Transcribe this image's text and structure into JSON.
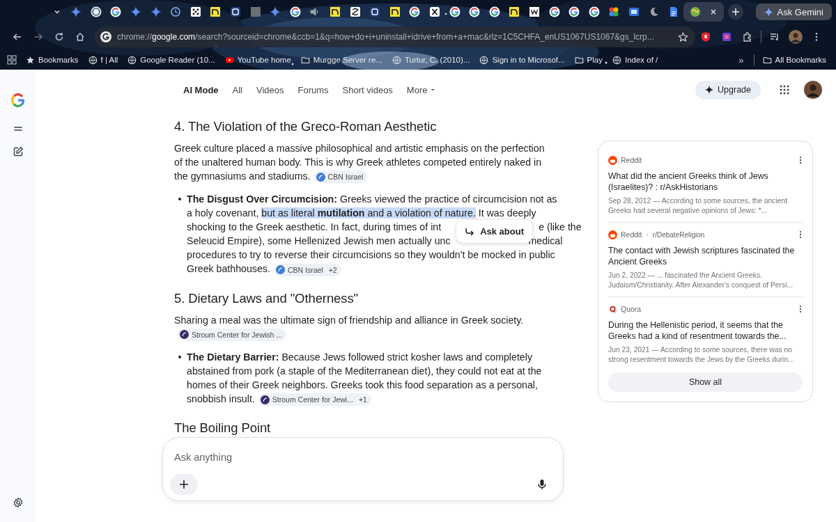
{
  "browser": {
    "tabs": [
      {
        "kind": "gemini",
        "selected": false
      },
      {
        "kind": "wordpress",
        "selected": false
      },
      {
        "kind": "google",
        "selected": false
      },
      {
        "kind": "gemini",
        "selected": false
      },
      {
        "kind": "gemini",
        "selected": false
      },
      {
        "kind": "clock",
        "selected": false
      },
      {
        "kind": "dice",
        "selected": false
      },
      {
        "kind": "yellow",
        "selected": false
      },
      {
        "kind": "site",
        "selected": false
      },
      {
        "kind": "grey",
        "selected": false
      },
      {
        "kind": "gemini",
        "selected": false
      },
      {
        "kind": "google",
        "selected": false
      },
      {
        "kind": "speaker",
        "selected": false
      },
      {
        "kind": "yellow",
        "selected": false
      },
      {
        "kind": "swirl",
        "selected": false
      },
      {
        "kind": "site",
        "selected": false
      },
      {
        "kind": "yellow",
        "selected": false
      },
      {
        "kind": "google",
        "selected": false
      },
      {
        "kind": "x",
        "selected": false
      },
      {
        "kind": "google",
        "selected": false
      },
      {
        "kind": "google",
        "selected": false
      },
      {
        "kind": "google",
        "selected": false
      },
      {
        "kind": "yellow",
        "selected": false
      },
      {
        "kind": "wiki",
        "selected": false
      },
      {
        "kind": "google",
        "selected": false
      },
      {
        "kind": "google",
        "selected": false
      },
      {
        "kind": "google",
        "selected": false
      },
      {
        "kind": "photos",
        "selected": false
      },
      {
        "kind": "screen",
        "selected": false
      },
      {
        "kind": "moon",
        "selected": false
      },
      {
        "kind": "doc",
        "selected": false
      },
      {
        "kind": "globe",
        "selected": true
      }
    ],
    "ask_gemini": "Ask Gemini",
    "address": {
      "scheme": "chrome://",
      "host": "google.com",
      "path": "/search?sourceid=chrome&ccb=1&q=how+do+i+uninstall+idrive+from+a+mac&rlz=1C5CHFA_enUS1067US1067&gs_lcrp..."
    },
    "bookmarks": [
      {
        "kind": "star",
        "label": "Bookmarks"
      },
      {
        "kind": "globe",
        "label": "f | All"
      },
      {
        "kind": "globe",
        "label": "Google Reader (10..."
      },
      {
        "kind": "youtube",
        "label": "YouTube home"
      },
      {
        "kind": "folder",
        "label": "Murgge Server re..."
      },
      {
        "kind": "globe",
        "label": "Turtur, C. (2010)..."
      },
      {
        "kind": "globe",
        "label": "Sign in to Microsof..."
      },
      {
        "kind": "folder",
        "label": "Play"
      },
      {
        "kind": "globe",
        "label": "Index of /"
      }
    ],
    "overflow": "»",
    "all_bookmarks": "All Bookmarks"
  },
  "search_tabs": [
    {
      "label": "AI Mode",
      "selected": true
    },
    {
      "label": "All",
      "selected": false
    },
    {
      "label": "Videos",
      "selected": false
    },
    {
      "label": "Forums",
      "selected": false
    },
    {
      "label": "Short videos",
      "selected": false
    },
    {
      "label": "More",
      "selected": false
    }
  ],
  "upgrade": "Upgrade",
  "content": [
    {
      "kind": "heading",
      "text": "4. The Violation of the Greco-Roman Aesthetic"
    },
    {
      "kind": "paragraph",
      "text": "Greek culture placed a massive philosophical and artistic emphasis on the perfection of the unaltered human body. This is why Greek athletes competed entirely naked in the gymnasiums and stadiums.",
      "chip": {
        "kind": "cbn",
        "label": "CBN Israel"
      }
    },
    {
      "kind": "bullet",
      "lines": [
        {
          "text": "**The Disgust Over Circumcision:** Greeks viewed the practice of circumcision not as"
        },
        {
          "before": "a holy covenant, ",
          "selection": "but as literal **mutilation** and a violation of nature.",
          "after": " It was deeply"
        },
        {
          "left": "shocking to the Greek aesthetic. In fact, during times of int",
          "right": "e (like the"
        },
        {
          "left": "Seleucid Empire), some Hellenized Jewish men actually unc",
          "right": "medical"
        },
        {
          "text": "procedures to try to reverse their circumcisions so they wouldn't be mocked in public"
        },
        {
          "text": "Greek bathhouses."
        }
      ],
      "chip": {
        "kind": "cbn",
        "label": "CBN Israel",
        "extra": "+2"
      }
    },
    {
      "kind": "heading",
      "text": "5. Dietary Laws and \"Otherness\""
    },
    {
      "kind": "paragraph",
      "text": "Sharing a meal was the ultimate sign of friendship and alliance in Greek society.",
      "chip": {
        "kind": "stroum",
        "label": "Stroum Center for Jewish ..."
      }
    },
    {
      "kind": "bullet",
      "text": "**The Dietary Barrier:** Because Jews followed strict kosher laws and completely abstained from pork (a staple of the Mediterranean diet), they could not eat at the homes of their Greek neighbors. Greeks took this food separation as a personal, snobbish insult.",
      "chip": {
        "kind": "stroum",
        "label": "Stroum Center for Jewi...",
        "extra": "+1"
      }
    },
    {
      "kind": "heading",
      "text": "The Boiling Point"
    }
  ],
  "ask_about": "Ask about",
  "sources": [
    {
      "kind": "reddit",
      "site": "Reddit",
      "title": "What did the ancient Greeks think of Jews (Israelites)? : r/AskHistorians",
      "snippet": "Sep 28, 2012 — According to some sources, the ancient Greeks had several negative opinions of Jews: *..."
    },
    {
      "kind": "reddit",
      "site": "Reddit",
      "separator": "·",
      "sub": "r/DebateReligion",
      "title": "The contact with Jewish scriptures fascinated the Ancient Greeks",
      "snippet": "Jun 2, 2022 — ... fascinated the Ancient Greeks. Judaism/Christianity. After Alexander's conquest of Persi..."
    },
    {
      "kind": "quora",
      "site": "Quora",
      "title": "During the Hellenistic period, it seems that the Greeks had a kind of resentment towards the...",
      "snippet": "Jun 23, 2021 — According to some sources, there was no strong resentment towards the Jews by the Greeks durin..."
    }
  ],
  "show_all": "Show all",
  "prompt": {
    "placeholder": "Ask anything"
  }
}
